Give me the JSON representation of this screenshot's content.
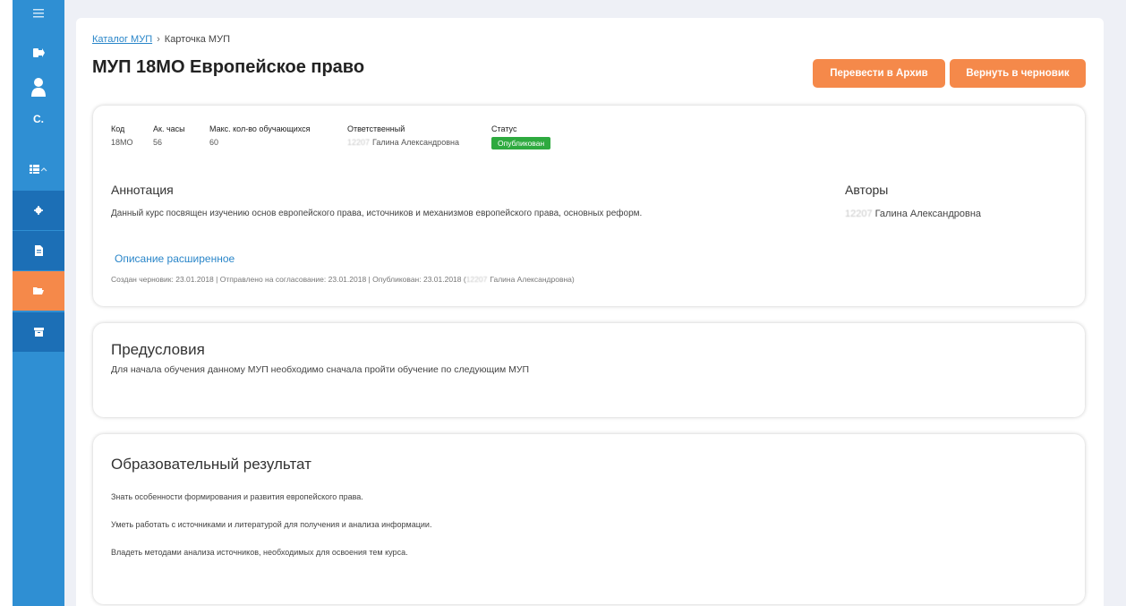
{
  "sidebar": {
    "user_initial": "С."
  },
  "breadcrumb": {
    "catalog_link": "Каталог МУП",
    "separator": "›",
    "current": "Карточка МУП"
  },
  "page_title": "МУП 18МО Европейское право",
  "actions": {
    "archive_label": "Перевести в Архив",
    "draft_label": "Вернуть в черновик"
  },
  "info": {
    "code_label": "Код",
    "code_value": "18МО",
    "hours_label": "Ак. часы",
    "hours_value": "56",
    "max_label": "Макс. кол-во обучающихся",
    "max_value": "60",
    "responsible_label": "Ответственный",
    "responsible_blur": "12207",
    "responsible_name": "Галина Александровна",
    "status_label": "Статус",
    "status_value": "Опубликован"
  },
  "annotation": {
    "title": "Аннотация",
    "text": "Данный курс посвящен изучению основ европейского права, источников и механизмов европейского права, основных реформ.",
    "extended_link": "Описание расширенное",
    "history": "Создан черновик: 23.01.2018 | Отправлено на согласование: 23.01.2018 | Опубликован: 23.01.2018 (",
    "history_blur": "12207",
    "history_end": "Галина Александровна)"
  },
  "authors": {
    "title": "Авторы",
    "blur": "12207",
    "name": "Галина Александровна"
  },
  "prerequisites": {
    "title": "Предусловия",
    "text": "Для начала обучения данному МУП необходимо сначала пройти обучение по следующим МУП"
  },
  "outcomes": {
    "title": "Образовательный результат",
    "items": [
      "Знать особенности формирования и развития европейского права.",
      "Уметь работать с источниками и литературой для получения и анализа информации.",
      "Владеть методами анализа источников, необходимых для освоения тем курса."
    ]
  },
  "colors": {
    "sidebar": "#2f8fd3",
    "sidebar_dark": "#1c6fb6",
    "accent_orange": "#f5894a",
    "status_green": "#2eaa3f",
    "link_blue": "#2a86c9"
  }
}
